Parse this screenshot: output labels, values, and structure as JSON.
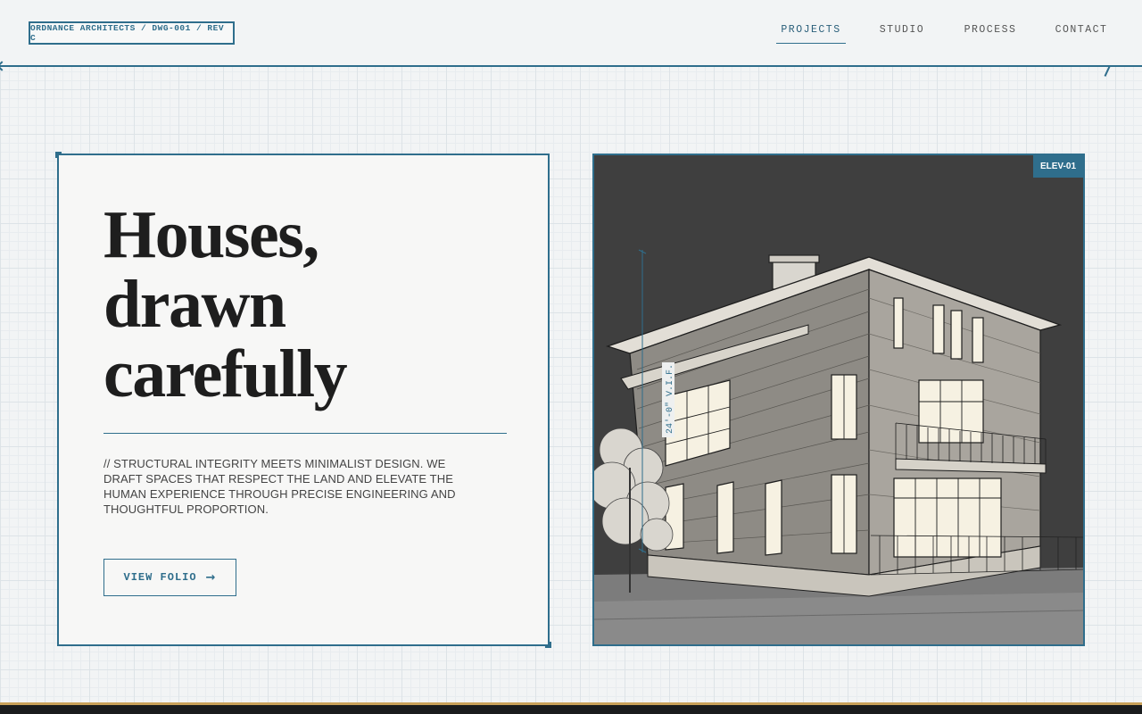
{
  "header": {
    "drawing_label": "ORDNANCE ARCHITECTS / DWG-001 / REV C",
    "nav": [
      {
        "label": "PROJECTS",
        "active": true
      },
      {
        "label": "STUDIO",
        "active": false
      },
      {
        "label": "PROCESS",
        "active": false
      },
      {
        "label": "CONTACT",
        "active": false
      }
    ]
  },
  "hero": {
    "headline_lines": [
      "Houses,",
      "drawn",
      "carefully"
    ],
    "tagline": "// STRUCTURAL INTEGRITY MEETS MINIMALIST DESIGN. WE DRAFT SPACES THAT RESPECT THE LAND AND ELEVATE THE HUMAN EXPERIENCE THROUGH PRECISE ENGINEERING AND THOUGHTFUL PROPORTION.",
    "cta_label": "VIEW FOLIO",
    "cta_icon": "arrow-right-icon"
  },
  "image": {
    "tag": "ELEV-01",
    "dimension_label": "24'-0\" V.I.F."
  },
  "colors": {
    "accent": "#2f6e8c",
    "background": "#f2f4f5",
    "image_bg": "#3d3d3d",
    "footer": "#1a1c1d",
    "footer_accent": "#c9a15a"
  }
}
